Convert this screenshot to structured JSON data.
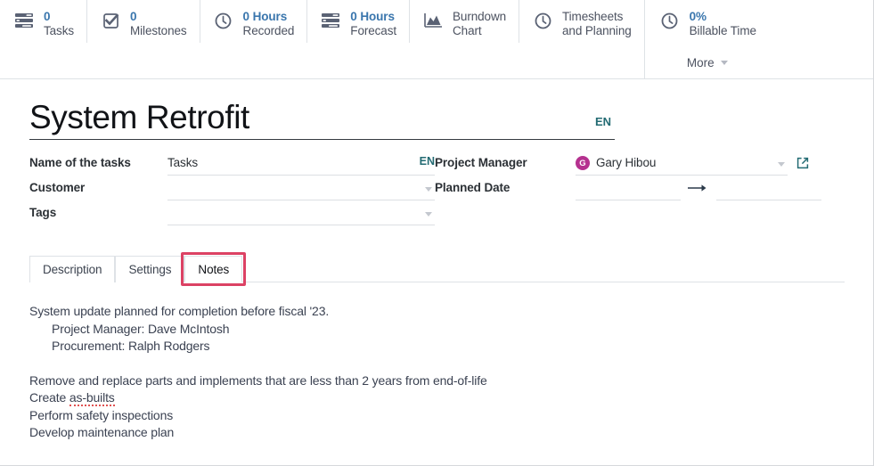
{
  "statbar": {
    "cells": [
      {
        "icon": "tasks-list-icon",
        "value": "0",
        "label": "Tasks",
        "name": "stat-tasks"
      },
      {
        "icon": "checkbox-check-icon",
        "value": "0",
        "label": "Milestones",
        "name": "stat-milestones"
      },
      {
        "icon": "clock-icon",
        "value": "0 Hours",
        "label": "Recorded",
        "name": "stat-hours-recorded"
      },
      {
        "icon": "tasks-list-icon",
        "value": "0 Hours",
        "label": "Forecast",
        "name": "stat-hours-forecast"
      },
      {
        "icon": "area-chart-icon",
        "value": "",
        "label": "Burndown\nChart",
        "name": "stat-burndown-chart"
      },
      {
        "icon": "clock-icon",
        "value": "",
        "label": "Timesheets\nand Planning",
        "name": "stat-timesheets-planning"
      }
    ],
    "billable": {
      "icon": "clock-icon",
      "value": "0%",
      "label": "Billable Time",
      "more_label": "More"
    },
    "value_color": "#3a76ad",
    "label_color": "#4c5260"
  },
  "record": {
    "title": "System Retrofit",
    "title_lang_badge": "EN",
    "fields_left": [
      {
        "label": "Name of the tasks",
        "value": "Tasks",
        "lang_badge": "EN",
        "type": "text-with-lang",
        "name": "name-of-the-tasks"
      },
      {
        "label": "Customer",
        "value": "",
        "placeholder": "",
        "type": "dropdown",
        "name": "customer"
      },
      {
        "label": "Tags",
        "value": "",
        "placeholder": "",
        "type": "dropdown",
        "name": "tags"
      }
    ],
    "fields_right": [
      {
        "label": "Project Manager",
        "value": "Gary Hibou",
        "avatar_initial": "G",
        "avatar_color": "#b5318f",
        "type": "many2one",
        "name": "project-manager"
      },
      {
        "label": "Planned Date",
        "start": "",
        "end": "",
        "type": "date-range",
        "name": "planned-date"
      }
    ]
  },
  "tabs": {
    "items": [
      {
        "label": "Description",
        "active": false
      },
      {
        "label": "Settings",
        "active": false
      },
      {
        "label": "Notes",
        "active": true
      }
    ],
    "highlight_color": "#dc4264",
    "highlighted_tab": "Notes"
  },
  "notes": {
    "lines": [
      {
        "text": "System update planned for completion before fiscal '23.",
        "indent": false
      },
      {
        "text": "Project Manager: Dave McIntosh",
        "indent": true
      },
      {
        "text": "Procurement: Ralph Rodgers",
        "indent": true
      },
      {
        "text": "",
        "indent": false
      },
      {
        "text": "Remove and replace parts and implements that are less than 2 years from end-of-life",
        "indent": false
      },
      {
        "text": "Create as-builts",
        "indent": false,
        "spellcheck_word": "as-builts"
      },
      {
        "text": "Perform safety inspections",
        "indent": false
      },
      {
        "text": "Develop maintenance plan",
        "indent": false
      }
    ]
  }
}
